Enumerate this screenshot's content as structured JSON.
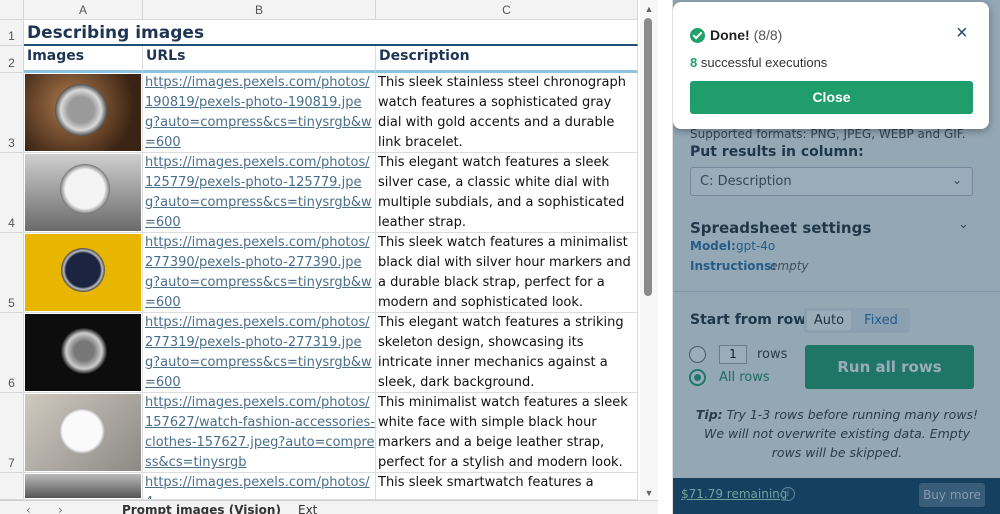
{
  "sheet": {
    "columns": [
      "A",
      "B",
      "C"
    ],
    "row_numbers": [
      "1",
      "2",
      "3",
      "4",
      "5",
      "6",
      "7"
    ],
    "title": "Describing images",
    "headers": {
      "images": "Images",
      "urls": "URLs",
      "description": "Description"
    },
    "rows": [
      {
        "url": "https://images.pexels.com/photos/190819/pexels-photo-190819.jpeg?auto=compress&cs=tinysrgb&w=600",
        "description": "This sleek stainless steel chronograph watch features a sophisticated gray dial with gold accents and a durable link bracelet."
      },
      {
        "url": "https://images.pexels.com/photos/125779/pexels-photo-125779.jpeg?auto=compress&cs=tinysrgb&w=600",
        "description": "This elegant watch features a sleek silver case, a classic white dial with multiple subdials, and a sophisticated leather strap."
      },
      {
        "url": "https://images.pexels.com/photos/277390/pexels-photo-277390.jpeg?auto=compress&cs=tinysrgb&w=600",
        "description": "This sleek watch features a minimalist black dial with silver hour markers and a durable black strap, perfect for a modern and sophisticated look."
      },
      {
        "url": "https://images.pexels.com/photos/277319/pexels-photo-277319.jpeg?auto=compress&cs=tinysrgb&w=600",
        "description": "This elegant watch features a striking skeleton design, showcasing its intricate inner mechanics against a sleek, dark background."
      },
      {
        "url": "https://images.pexels.com/photos/157627/watch-fashion-accessories-clothes-157627.jpeg?auto=compress&cs=tinysrgb",
        "description": "This minimalist watch features a sleek white face with simple black hour markers and a beige leather strap, perfect for a stylish and modern look."
      },
      {
        "url": "https://images.pexels.com/photos/4",
        "description": "This sleek smartwatch features a"
      }
    ],
    "tabs": {
      "active": "Prompt images (Vision)",
      "other": "Ext"
    }
  },
  "panel": {
    "toast": {
      "title": "Done!",
      "count": "(8/8)",
      "success_count": "8",
      "success_text": "successful executions",
      "close_button": "Close",
      "close_icon": "×"
    },
    "supported_formats": "Supported formats: PNG, JPEG, WEBP and GIF.",
    "results_label": "Put results in column:",
    "results_value": "C: Description",
    "settings_label": "Spreadsheet settings",
    "model_label": "Model:",
    "model_value": "gpt-4o",
    "instructions_label": "Instructions:",
    "instructions_value": "empty",
    "start_row_label": "Start from row:",
    "start_options": [
      "Auto",
      "Fixed"
    ],
    "rows_value": "1",
    "rows_label": "rows",
    "all_rows_label": "All rows",
    "run_button": "Run all rows",
    "tip_label": "Tip:",
    "tip_text": "Try 1-3 rows before running many rows! We will not overwrite existing data. Empty rows will be skipped.",
    "remaining": "$71.79 remaining",
    "buy_button": "Buy more"
  },
  "colors": {
    "accent_green": "#1f9d6a",
    "header_text": "#1f3554",
    "link": "#4a6f8a",
    "footer_bg": "#0e3b5c"
  }
}
